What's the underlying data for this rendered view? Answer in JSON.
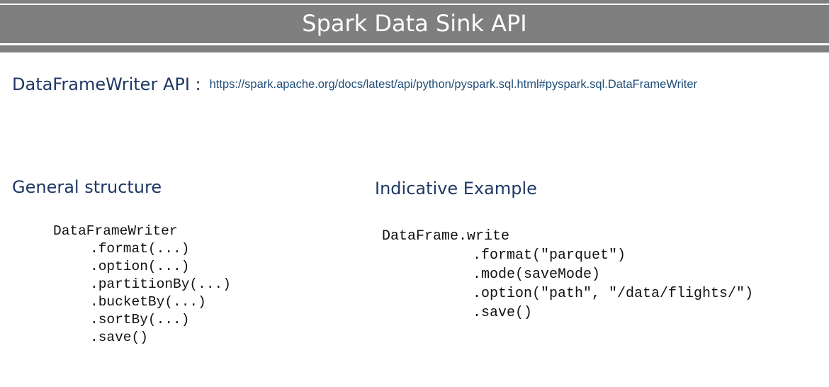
{
  "slide": {
    "title": "Spark Data Sink API"
  },
  "api_reference": {
    "label": "DataFrameWriter API :",
    "url": "https://spark.apache.org/docs/latest/api/python/pyspark.sql.html#pyspark.sql.DataFrameWriter"
  },
  "general_structure": {
    "heading": "General structure",
    "code": {
      "head": "DataFrameWriter",
      "lines": [
        ".format(...)",
        ".option(...)",
        ".partitionBy(...)",
        ".bucketBy(...)",
        ".sortBy(...)",
        ".save()"
      ]
    }
  },
  "indicative_example": {
    "heading": "Indicative Example",
    "code": {
      "head": "DataFrame.write",
      "lines": [
        ".format(\"parquet\")",
        ".mode(saveMode)",
        ".option(\"path\", \"/data/flights/\")",
        ".save()"
      ]
    }
  }
}
